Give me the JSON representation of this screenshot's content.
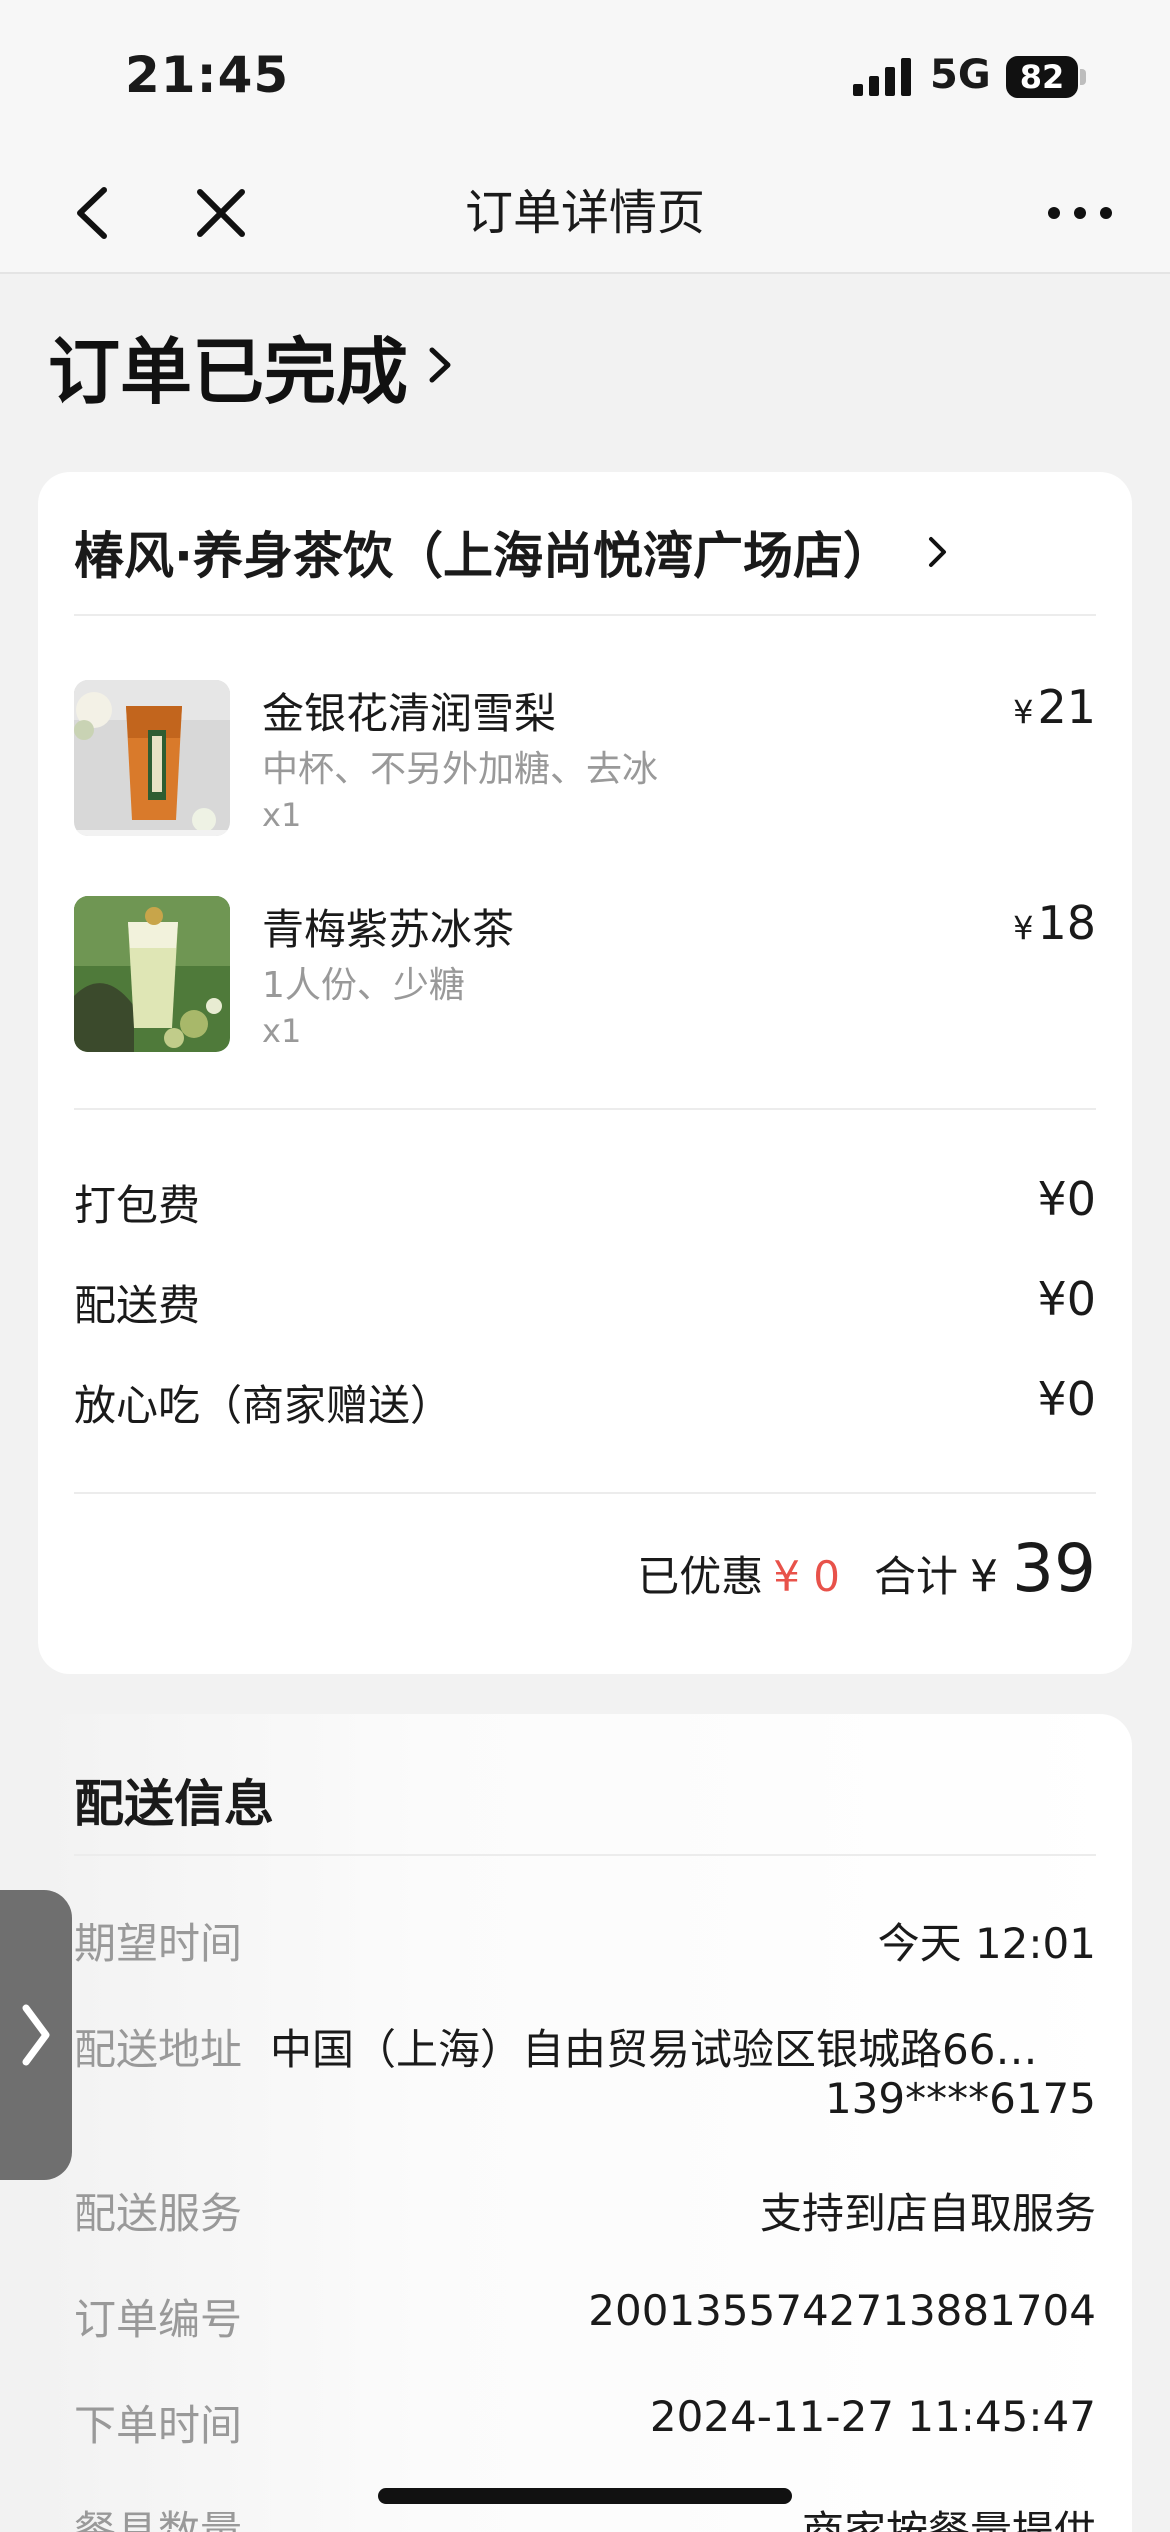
{
  "status_bar": {
    "time": "21:45",
    "network": "5G",
    "battery": "82"
  },
  "nav": {
    "title": "订单详情页",
    "icons": [
      "back-arrow-icon",
      "close-icon",
      "more-icon"
    ]
  },
  "order_status": "订单已完成",
  "store": {
    "name": "椿风·养身茶饮（上海尚悦湾广场店）"
  },
  "items": [
    {
      "name": "金银花清润雪梨",
      "spec": "中杯、不另外加糖、去冰",
      "qty": "x1",
      "currency": "¥",
      "price": "21"
    },
    {
      "name": "青梅紫苏冰茶",
      "spec": "1人份、少糖",
      "qty": "x1",
      "currency": "¥",
      "price": "18"
    }
  ],
  "fees": [
    {
      "label": "打包费",
      "value": "¥0"
    },
    {
      "label": "配送费",
      "value": "¥0"
    },
    {
      "label": "放心吃（商家赠送）",
      "value": "¥0"
    }
  ],
  "summary": {
    "discount_label": "已优惠",
    "discount_value": "¥ 0",
    "total_label": "合计",
    "total_currency": "¥",
    "total_value": "39"
  },
  "delivery": {
    "title": "配送信息",
    "rows": [
      {
        "label": "期望时间",
        "value": "今天 12:01"
      },
      {
        "label": "配送地址",
        "value": "中国（上海）自由贸易试验区银城路66…",
        "phone": "139****6175"
      },
      {
        "label": "配送服务",
        "value": "支持到店自取服务"
      },
      {
        "label": "订单编号",
        "value": "2001355742713881704"
      },
      {
        "label": "下单时间",
        "value": "2024-11-27 11:45:47"
      },
      {
        "label": "餐具数量",
        "value": "商家按餐量提供"
      }
    ]
  },
  "colors": {
    "discount_red": "#e8524a",
    "muted_gray": "#999999",
    "background": "#f2f2f2"
  }
}
